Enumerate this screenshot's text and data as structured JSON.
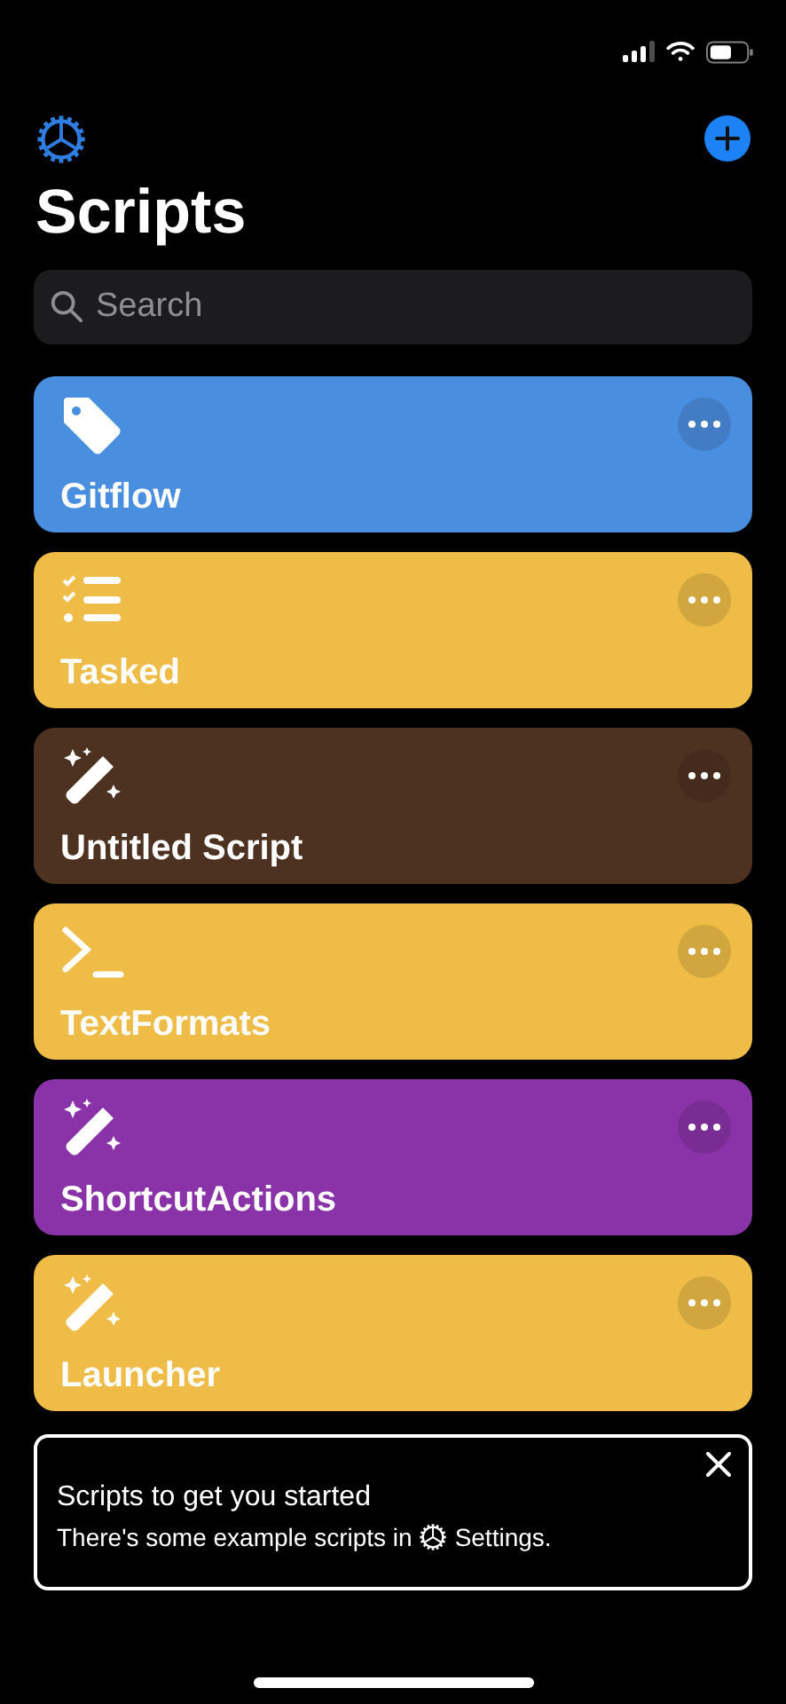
{
  "title": "Scripts",
  "search": {
    "placeholder": "Search"
  },
  "scripts": [
    {
      "name": "Gitflow",
      "kind": "tag",
      "color": "#4a8ee0"
    },
    {
      "name": "Tasked",
      "kind": "checklist",
      "color": "#efbd47"
    },
    {
      "name": "Untitled Script",
      "kind": "wand",
      "color": "#4e3221"
    },
    {
      "name": "TextFormats",
      "kind": "terminal",
      "color": "#efbd47"
    },
    {
      "name": "ShortcutActions",
      "kind": "wand",
      "color": "#8a33a8"
    },
    {
      "name": "Launcher",
      "kind": "wand",
      "color": "#efbd47"
    }
  ],
  "tip": {
    "title": "Scripts to get you started",
    "text_before": "There's some example scripts in",
    "text_after": "Settings."
  }
}
